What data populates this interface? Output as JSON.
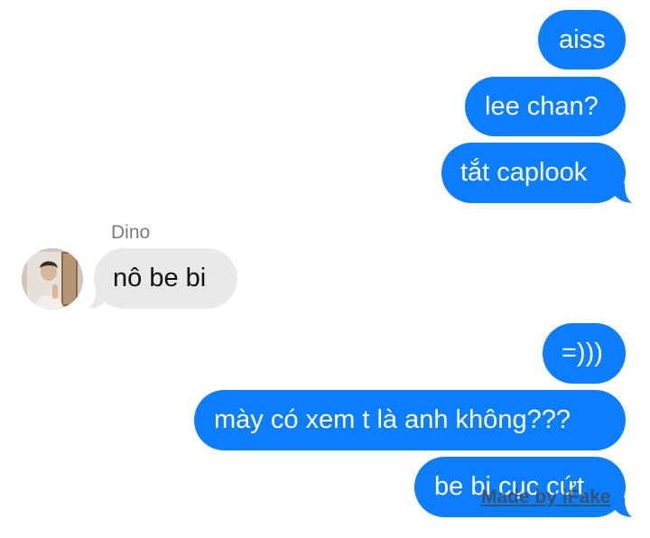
{
  "contact": {
    "name": "Dino",
    "avatar_icon": "profile-photo"
  },
  "colors": {
    "outgoing": "#0b7dff",
    "incoming": "#e9e9eb",
    "sender_name": "#7b7b80"
  },
  "messages": [
    {
      "direction": "outgoing",
      "text": "aiss"
    },
    {
      "direction": "outgoing",
      "text": "lee chan?"
    },
    {
      "direction": "outgoing",
      "text": "tắt caplook"
    },
    {
      "direction": "incoming",
      "sender": "Dino",
      "text": "nô be bi"
    },
    {
      "direction": "outgoing",
      "text": "=)))"
    },
    {
      "direction": "outgoing",
      "text": "mày có xem t là anh không???"
    },
    {
      "direction": "outgoing",
      "text": "be bi cục cứt"
    }
  ],
  "watermark": "Made by iFake"
}
